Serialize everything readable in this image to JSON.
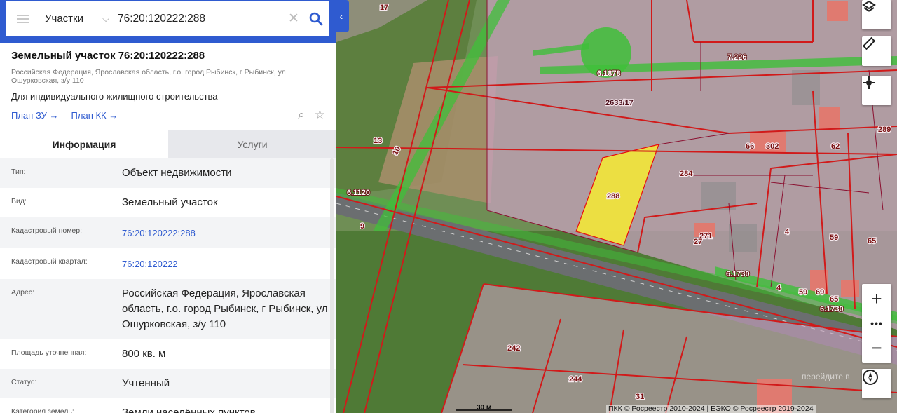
{
  "search": {
    "category": "Участки",
    "query": "76:20:120222:288"
  },
  "object": {
    "title": "Земельный участок 76:20:120222:288",
    "address_short": "Российская Федерация, Ярославская область, г.о. город Рыбинск, г Рыбинск, ул Ошурковская, з/у 110",
    "permitted_use": "Для индивидуального жилищного строительства",
    "links": [
      "План ЗУ →",
      "План КК →"
    ]
  },
  "tabs": [
    "Информация",
    "Услуги"
  ],
  "properties": [
    {
      "label": "Тип:",
      "value": "Объект недвижимости",
      "link": false
    },
    {
      "label": "Вид:",
      "value": "Земельный участок",
      "link": false
    },
    {
      "label": "Кадастровый номер:",
      "value": "76:20:120222:288",
      "link": true
    },
    {
      "label": "Кадастровый квартал:",
      "value": "76:20:120222",
      "link": true
    },
    {
      "label": "Адрес:",
      "value": "Российская Федерация, Ярославская область, г.о. город Рыбинск, г Рыбинск, ул Ошурковская, з/у 110",
      "link": false
    },
    {
      "label": "Площадь уточненная:",
      "value": "800 кв. м",
      "link": false
    },
    {
      "label": "Статус:",
      "value": "Учтенный",
      "link": false
    },
    {
      "label": "Категория земель:",
      "value": "Земли населённых пунктов",
      "link": false
    }
  ],
  "map": {
    "parcel_labels": [
      "17",
      "7.226",
      "6.1878",
      "2633/17",
      "13",
      "10",
      "6.1120",
      "9",
      "288",
      "284",
      "66",
      "302",
      "62",
      "289",
      "271",
      "27",
      "4",
      "59",
      "65",
      "6.1730",
      "4",
      "59",
      "69",
      "65",
      "6.1730",
      "242",
      "244",
      "31"
    ],
    "scale": "30 м",
    "attribution": "ПКК © Росреестр 2010-2024 | ЕЭКО © Росреестр 2019-2024",
    "watermark": "перейдите в"
  },
  "colors": {
    "accent": "#2f5bd0",
    "parcel_border": "#d11a1a",
    "selected_parcel": "#f2e53a",
    "zone_green": "#3fbf3a"
  },
  "icons": [
    "menu-icon",
    "chevron-down-icon",
    "clear-icon",
    "search-icon",
    "layers-icon",
    "ruler-icon",
    "crosshair-icon",
    "zoom-in-icon",
    "more-icon",
    "zoom-out-icon",
    "compass-icon",
    "collapse-icon",
    "zoom-doc-icon",
    "star-icon"
  ]
}
